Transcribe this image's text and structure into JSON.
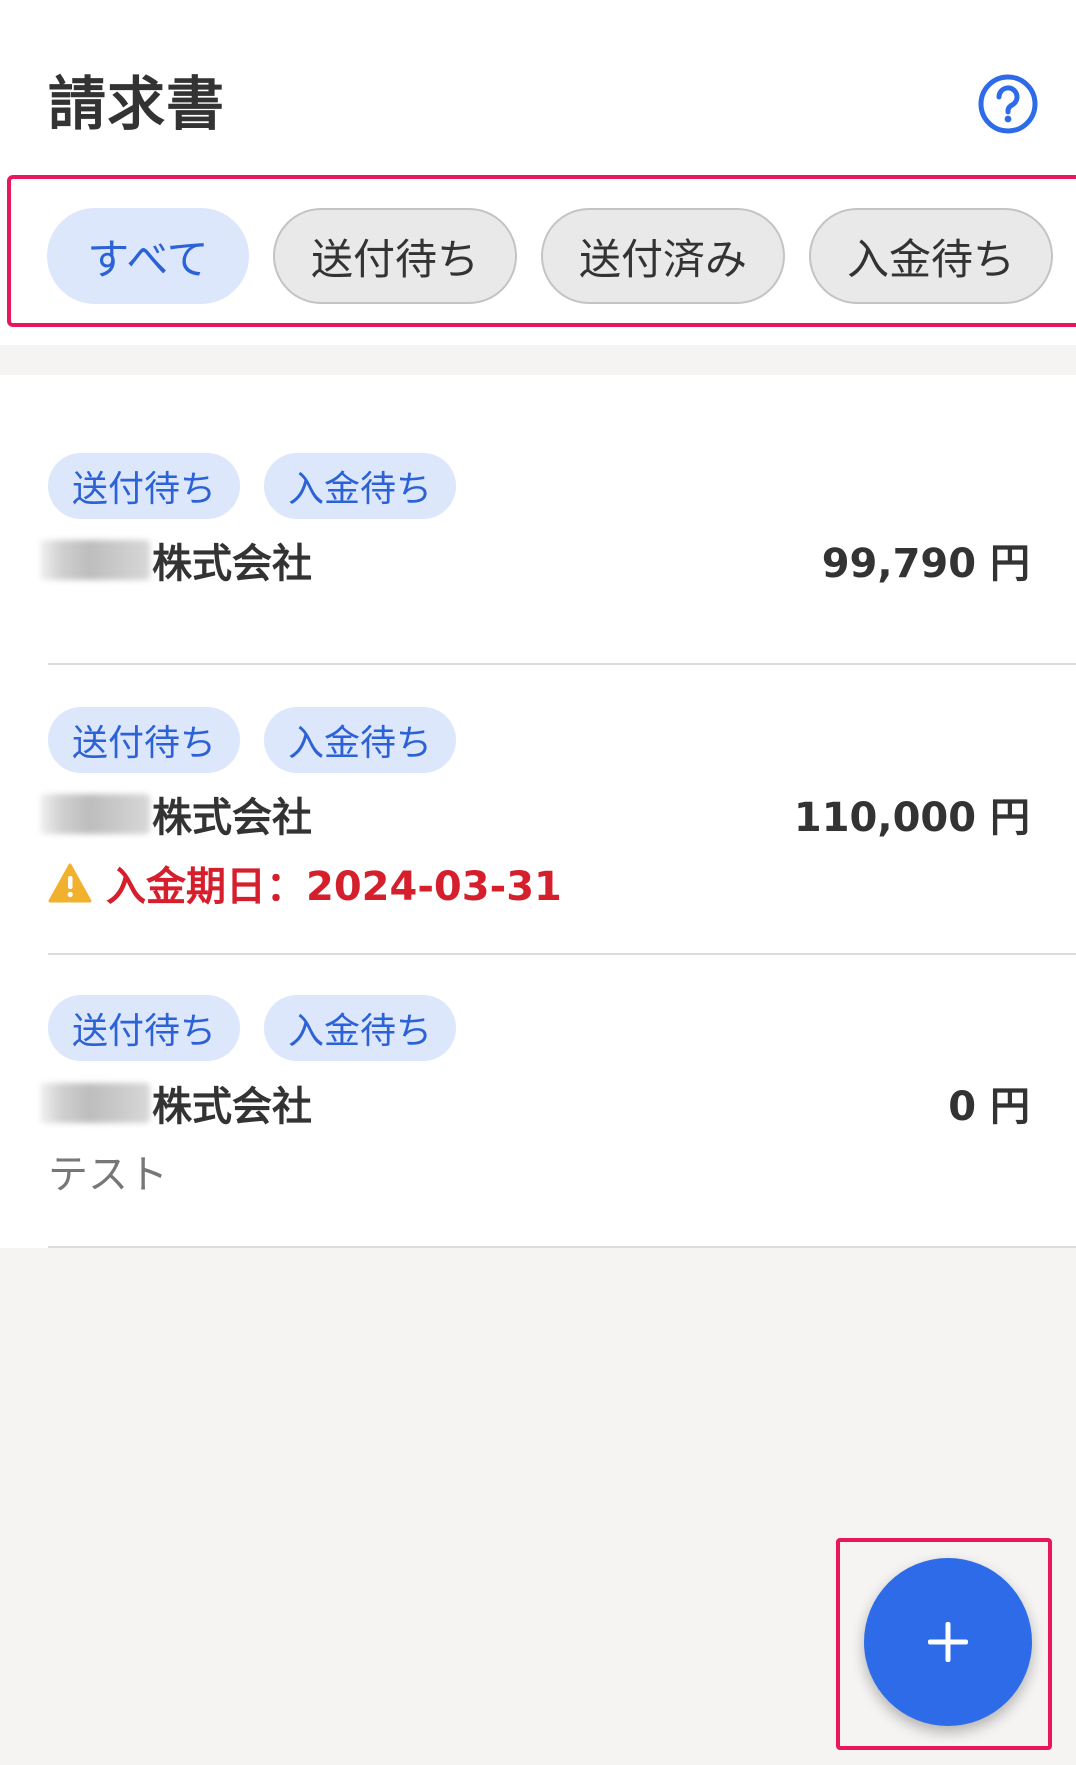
{
  "header": {
    "title": "請求書"
  },
  "filters": [
    {
      "label": "すべて",
      "selected": true
    },
    {
      "label": "送付待ち",
      "selected": false
    },
    {
      "label": "送付済み",
      "selected": false
    },
    {
      "label": "入金待ち",
      "selected": false
    }
  ],
  "invoices": [
    {
      "tags": [
        "送付待ち",
        "入金待ち"
      ],
      "company": "株式会社",
      "amount": "99,790 円"
    },
    {
      "tags": [
        "送付待ち",
        "入金待ち"
      ],
      "company": "株式会社",
      "amount": "110,000 円",
      "due": "入金期日：2024-03-31"
    },
    {
      "tags": [
        "送付待ち",
        "入金待ち"
      ],
      "company": "株式会社",
      "amount": "0 円",
      "memo": "テスト"
    }
  ],
  "icons": {
    "help": "help-circle-icon",
    "warning": "warning-triangle-icon",
    "add": "plus-icon"
  },
  "colors": {
    "accent": "#2d6be8",
    "chip_selected_bg": "#dce7fb",
    "warning": "#f2b12d",
    "due_text": "#d61f2c",
    "highlight": "#e8175d"
  }
}
